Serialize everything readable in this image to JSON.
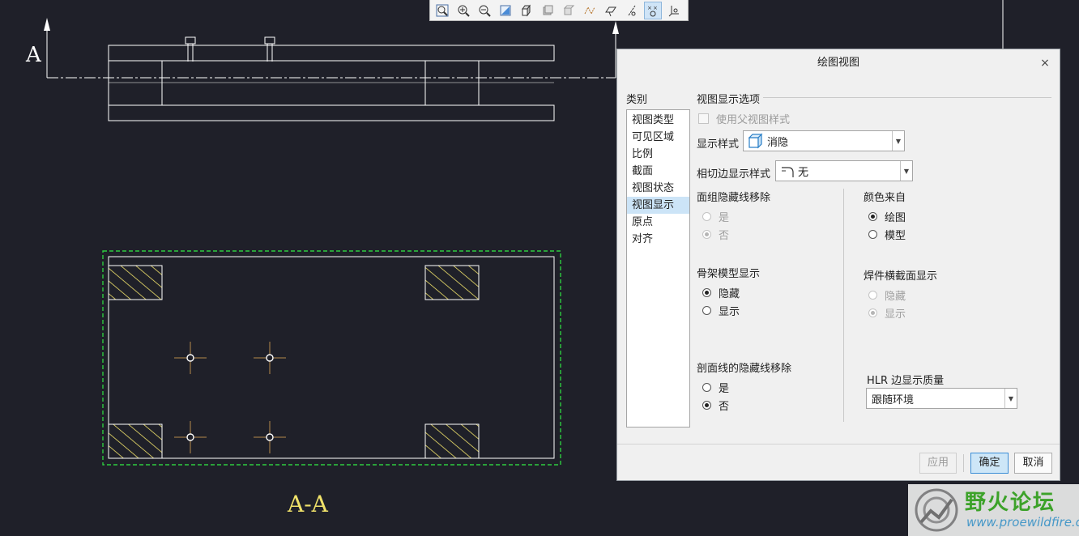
{
  "drawing": {
    "section_arrow_label": "A",
    "section_label": "A-A",
    "colors": {
      "background": "#1f2029",
      "line": "#ffffff",
      "hatch": "#f0e26a",
      "bbox": "#2ecc40",
      "section_text": "#f0e26a"
    }
  },
  "toolbar": {
    "icons": [
      "zoom-refit-icon",
      "zoom-in-icon",
      "zoom-out-icon",
      "repaint-icon",
      "view-orient-icon",
      "saved-views-icon",
      "display-style-icon",
      "datum-display-icon",
      "datum-plane-icon",
      "datum-axis-icon",
      "datum-point-icon",
      "coordinate-system-icon"
    ],
    "active_index": 10
  },
  "dialog": {
    "title": "绘图视图",
    "close": "×",
    "category_label": "类别",
    "categories": [
      "视图类型",
      "可见区域",
      "比例",
      "截面",
      "视图状态",
      "视图显示",
      "原点",
      "对齐"
    ],
    "selected_category": 5,
    "section_title": "视图显示选项",
    "use_parent_style": "使用父视图样式",
    "display_style_label": "显示样式",
    "display_style_value": "消隐",
    "tangent_label": "相切边显示样式",
    "tangent_value": "无",
    "quilt_hlr": {
      "label": "面组隐藏线移除",
      "yes": "是",
      "no": "否"
    },
    "skeleton": {
      "label": "骨架模型显示",
      "hide": "隐藏",
      "show": "显示"
    },
    "section_hlr": {
      "label": "剖面线的隐藏线移除",
      "yes": "是",
      "no": "否"
    },
    "color_from": {
      "label": "颜色来自",
      "drawing": "绘图",
      "model": "模型"
    },
    "weld_xsec": {
      "label": "焊件横截面显示",
      "hide": "隐藏",
      "show": "显示"
    },
    "hlr_quality": {
      "label": "HLR 边显示质量",
      "value": "跟随环境"
    },
    "buttons": {
      "apply": "应用",
      "ok": "确定",
      "cancel": "取消"
    }
  },
  "watermark": {
    "cn": "野火论坛",
    "url": "www.proewildfire.cn"
  }
}
